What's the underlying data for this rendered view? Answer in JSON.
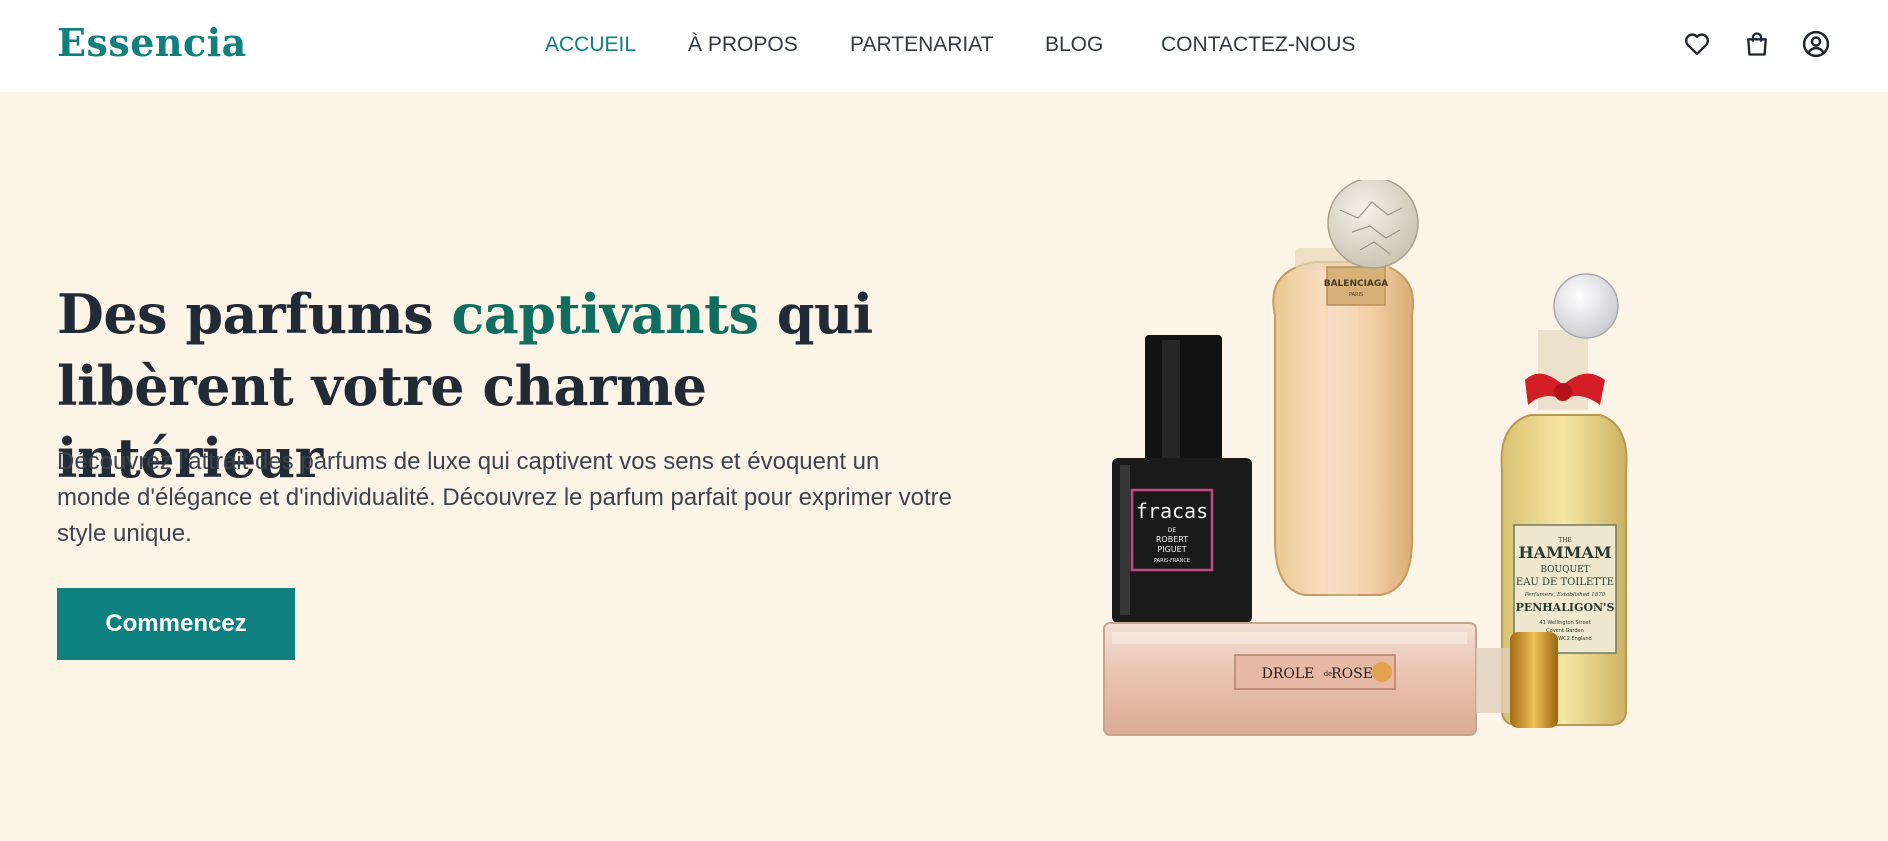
{
  "brand": {
    "logo": "Essencia",
    "accent_color": "#0f7f7f"
  },
  "nav": {
    "items": [
      {
        "label": "ACCUEIL",
        "active": true
      },
      {
        "label": "À PROPOS"
      },
      {
        "label": "PARTENARIAT"
      },
      {
        "label": "BLOG"
      },
      {
        "label": "CONTACTEZ-NOUS"
      }
    ]
  },
  "header_icons": [
    "heart-icon",
    "shopping-bag-icon",
    "user-icon"
  ],
  "hero": {
    "headline_part1": "Des parfums ",
    "headline_accent": "captivants",
    "headline_part2": " qui libèrent votre charme intérieur",
    "description": "Découvrez l'attrait des parfums de luxe qui captivent vos sens et évoquent un monde d'élégance et d'individualité. Découvrez le parfum parfait pour exprimer votre style unique.",
    "cta_label": "Commencez",
    "background": "#fdf4e8"
  },
  "product_labels": {
    "fracas": [
      "fracas",
      "DE",
      "ROBERT",
      "PIGUET",
      "PARIS-FRANCE"
    ],
    "balenciaga": [
      "BALENCIAGA",
      "PARIS"
    ],
    "penhaligons": [
      "THE",
      "HAMMAM",
      "BOUQUET",
      "EAU DE TOILETTE",
      "Perfumers, Established 1870",
      "PENHALIGON'S",
      "41 Wellington Street",
      "Covent Garden",
      "London WC2 England"
    ],
    "drole": [
      "DROLE",
      "de",
      "ROSE"
    ]
  }
}
